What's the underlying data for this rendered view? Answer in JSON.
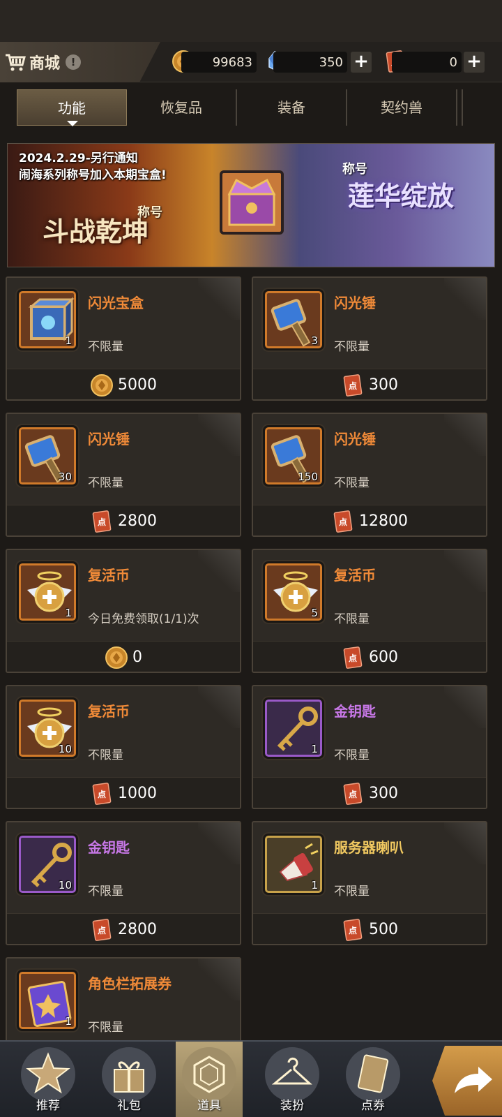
{
  "header": {
    "title": "商城",
    "info_icon": "!",
    "currencies": [
      {
        "icon": "gold-coin-icon",
        "value": "99683"
      },
      {
        "icon": "crystal-icon",
        "value": "350"
      },
      {
        "icon": "point-ticket-icon",
        "value": "0"
      }
    ],
    "plus": "+"
  },
  "tabs": [
    {
      "label": "功能",
      "active": true
    },
    {
      "label": "恢复品",
      "active": false
    },
    {
      "label": "装备",
      "active": false
    },
    {
      "label": "契约兽",
      "active": false
    }
  ],
  "banner": {
    "line1": "2024.2.29-另行通知",
    "line2": "闹海系列称号加入本期宝盒!",
    "left_tag": "称号",
    "left_title": "斗战乾坤",
    "right_tag": "称号",
    "right_title": "莲华绽放"
  },
  "items": [
    {
      "name": "闪光宝盒",
      "qty": "1",
      "limit": "不限量",
      "price": "5000",
      "currency": "gold-coin-icon",
      "rarity": "orange",
      "icon": "flash-box-icon"
    },
    {
      "name": "闪光锤",
      "qty": "3",
      "limit": "不限量",
      "price": "300",
      "currency": "point-ticket-icon",
      "rarity": "orange",
      "icon": "flash-hammer-icon"
    },
    {
      "name": "闪光锤",
      "qty": "30",
      "limit": "不限量",
      "price": "2800",
      "currency": "point-ticket-icon",
      "rarity": "orange",
      "icon": "flash-hammer-icon"
    },
    {
      "name": "闪光锤",
      "qty": "150",
      "limit": "不限量",
      "price": "12800",
      "currency": "point-ticket-icon",
      "rarity": "orange",
      "icon": "flash-hammer-icon"
    },
    {
      "name": "复活币",
      "qty": "1",
      "limit": "今日免费领取(1/1)次",
      "price": "0",
      "currency": "gold-coin-icon",
      "rarity": "orange",
      "icon": "revive-coin-icon"
    },
    {
      "name": "复活币",
      "qty": "5",
      "limit": "不限量",
      "price": "600",
      "currency": "point-ticket-icon",
      "rarity": "orange",
      "icon": "revive-coin-icon"
    },
    {
      "name": "复活币",
      "qty": "10",
      "limit": "不限量",
      "price": "1000",
      "currency": "point-ticket-icon",
      "rarity": "orange",
      "icon": "revive-coin-icon"
    },
    {
      "name": "金钥匙",
      "qty": "1",
      "limit": "不限量",
      "price": "300",
      "currency": "point-ticket-icon",
      "rarity": "purple",
      "icon": "gold-key-icon"
    },
    {
      "name": "金钥匙",
      "qty": "10",
      "limit": "不限量",
      "price": "2800",
      "currency": "point-ticket-icon",
      "rarity": "purple",
      "icon": "gold-key-icon"
    },
    {
      "name": "服务器喇叭",
      "qty": "1",
      "limit": "不限量",
      "price": "500",
      "currency": "point-ticket-icon",
      "rarity": "gold",
      "icon": "server-horn-icon"
    },
    {
      "name": "角色栏拓展券",
      "qty": "1",
      "limit": "不限量",
      "price": "",
      "currency": "",
      "rarity": "orange",
      "icon": "slot-ticket-icon"
    }
  ],
  "nav": [
    {
      "label": "推荐",
      "icon": "star-icon"
    },
    {
      "label": "礼包",
      "icon": "gift-icon"
    },
    {
      "label": "道具",
      "icon": "item-icon",
      "active": true
    },
    {
      "label": "装扮",
      "icon": "hanger-icon"
    },
    {
      "label": "点券",
      "icon": "ticket-icon"
    }
  ],
  "colors": {
    "orange": "#f08a38",
    "purple": "#c878e8",
    "gold": "#f0c860"
  }
}
